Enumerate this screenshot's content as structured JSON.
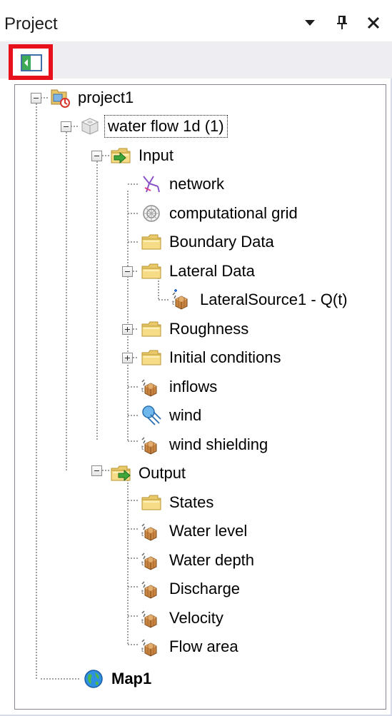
{
  "panel": {
    "title": "Project",
    "buttons": {
      "dropdown_icon": "chevron-down-icon",
      "pin_icon": "pin-icon",
      "close_icon": "close-icon"
    }
  },
  "toolbar": {
    "highlight_color": "#e8101a",
    "button_icon": "collapse-all-icon"
  },
  "tree": {
    "project": {
      "label": "project1",
      "icon": "project-icon"
    },
    "model": {
      "label": "water flow 1d (1)",
      "icon": "model-icon"
    },
    "input": {
      "label": "Input",
      "icon": "input-folder-icon",
      "items": {
        "network": "network",
        "computational_grid": "computational grid",
        "boundary_data": "Boundary Data",
        "lateral_data": "Lateral Data",
        "lateral_source": "LateralSource1 - Q(t)",
        "roughness": "Roughness",
        "initial_conditions": "Initial conditions",
        "inflows": "inflows",
        "wind": "wind",
        "wind_shielding": "wind shielding"
      }
    },
    "output": {
      "label": "Output",
      "icon": "output-folder-icon",
      "items": {
        "states": "States",
        "water_level": "Water level",
        "water_depth": "Water depth",
        "discharge": "Discharge",
        "velocity": "Velocity",
        "flow_area": "Flow area"
      }
    },
    "map": {
      "label": "Map1",
      "icon": "globe-icon"
    }
  }
}
